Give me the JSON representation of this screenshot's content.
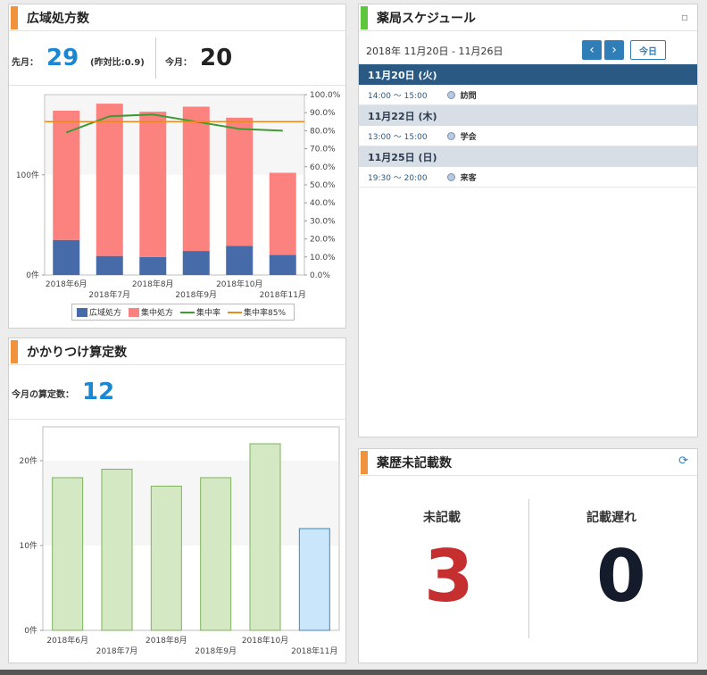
{
  "panels": {
    "wide_area": {
      "title": "広域処方数",
      "accent": "#f0923b",
      "prev_label": "先月：",
      "prev_value": "29",
      "yoy_label": "(昨対比:0.9)",
      "this_label": "今月：",
      "this_value": "20"
    },
    "kakaritsuke": {
      "title": "かかりつけ算定数",
      "accent": "#f0923b",
      "label": "今月の算定数：",
      "value": "12"
    },
    "schedule": {
      "title": "薬局スケジュール",
      "accent": "#5fc53c",
      "range": "2018年 11月20日 - 11月26日",
      "today_button": "今日",
      "prev_icon": "chevron-left-icon",
      "next_icon": "chevron-right-icon",
      "days": [
        {
          "date": "11月20日 (火)",
          "time": "14:00 ～ 15:00",
          "event": "訪問",
          "selected": true
        },
        {
          "date": "11月22日 (木)",
          "time": "13:00 ～ 15:00",
          "event": "学会",
          "selected": false
        },
        {
          "date": "11月25日 (日)",
          "time": "19:30 ～ 20:00",
          "event": "来客",
          "selected": false
        }
      ]
    },
    "unrecorded": {
      "title": "薬歴未記載数",
      "accent": "#f0923b",
      "refresh_icon": "refresh-icon",
      "left_label": "未記載",
      "left_value": "3",
      "right_label": "記載遅れ",
      "right_value": "0"
    }
  },
  "colors": {
    "blue_number": "#1a87d3",
    "red_number": "#c52f2f",
    "dark_number": "#141c2c",
    "bar_blue": "#476aa8",
    "bar_red": "#fc8280",
    "line_green": "#3f9a32",
    "line_orange": "#e98a1f",
    "bar_green": "#d4e8c4",
    "bar_light_blue": "#c9e6fb",
    "day_header_selected": "#2a5a84",
    "day_header": "#d8dee6"
  },
  "chart_data": [
    {
      "type": "bar",
      "stacked": true,
      "categories": [
        "2018年6月",
        "2018年7月",
        "2018年8月",
        "2018年9月",
        "2018年10月",
        "2018年11月"
      ],
      "series": [
        {
          "name": "広域処方",
          "values": [
            35,
            19,
            18,
            24,
            29,
            20
          ],
          "color": "#476aa8"
        },
        {
          "name": "集中処方",
          "values": [
            129,
            152,
            145,
            144,
            128,
            82
          ],
          "color": "#fc8280"
        }
      ],
      "lines": [
        {
          "name": "集中率",
          "values": [
            79,
            88,
            89,
            85,
            81,
            80
          ],
          "axis": "right",
          "color": "#3f9a32"
        },
        {
          "name": "集中率85%",
          "values": [
            85,
            85,
            85,
            85,
            85,
            85
          ],
          "axis": "right",
          "color": "#e98a1f"
        }
      ],
      "y_ticks_left": [
        "0件",
        "100件"
      ],
      "y_ticks_right": [
        "0.0%",
        "10.0%",
        "20.0%",
        "30.0%",
        "40.0%",
        "50.0%",
        "60.0%",
        "70.0%",
        "80.0%",
        "90.0%",
        "100.0%"
      ],
      "ylim_left": [
        0,
        180
      ],
      "ylim_right": [
        0,
        100
      ],
      "legend": "bottom"
    },
    {
      "type": "bar",
      "categories": [
        "2018年6月",
        "2018年7月",
        "2018年8月",
        "2018年9月",
        "2018年10月",
        "2018年11月"
      ],
      "values": [
        18,
        19,
        17,
        18,
        22,
        12
      ],
      "y_ticks": [
        "0件",
        "10件",
        "20件"
      ],
      "ylim": [
        0,
        24
      ]
    }
  ]
}
